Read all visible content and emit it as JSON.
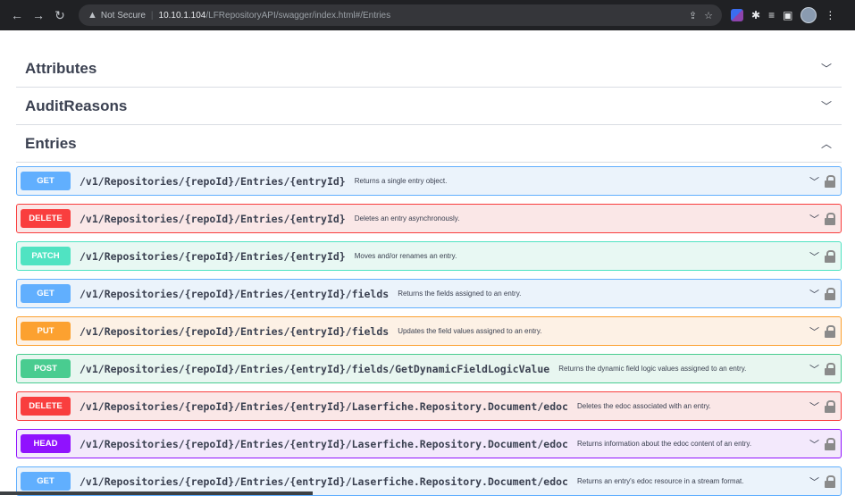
{
  "browser": {
    "security_label": "Not Secure",
    "url_host": "10.10.1.104",
    "url_path": "/LFRepositoryAPI/swagger/index.html#/Entries"
  },
  "tags": [
    {
      "name": "Attributes",
      "expanded": false
    },
    {
      "name": "AuditReasons",
      "expanded": false
    },
    {
      "name": "Entries",
      "expanded": true
    }
  ],
  "operations": [
    {
      "method": "GET",
      "path": "/v1/Repositories/{repoId}/Entries/{entryId}",
      "summary": "Returns a single entry object."
    },
    {
      "method": "DELETE",
      "path": "/v1/Repositories/{repoId}/Entries/{entryId}",
      "summary": "Deletes an entry asynchronously."
    },
    {
      "method": "PATCH",
      "path": "/v1/Repositories/{repoId}/Entries/{entryId}",
      "summary": "Moves and/or renames an entry."
    },
    {
      "method": "GET",
      "path": "/v1/Repositories/{repoId}/Entries/{entryId}/fields",
      "summary": "Returns the fields assigned to an entry."
    },
    {
      "method": "PUT",
      "path": "/v1/Repositories/{repoId}/Entries/{entryId}/fields",
      "summary": "Updates the field values assigned to an entry."
    },
    {
      "method": "POST",
      "path": "/v1/Repositories/{repoId}/Entries/{entryId}/fields/GetDynamicFieldLogicValue",
      "summary": "Returns the dynamic field logic values assigned to an entry."
    },
    {
      "method": "DELETE",
      "path": "/v1/Repositories/{repoId}/Entries/{entryId}/Laserfiche.Repository.Document/edoc",
      "summary": "Deletes the edoc associated with an entry."
    },
    {
      "method": "HEAD",
      "path": "/v1/Repositories/{repoId}/Entries/{entryId}/Laserfiche.Repository.Document/edoc",
      "summary": "Returns information about the edoc content of an entry."
    },
    {
      "method": "GET",
      "path": "/v1/Repositories/{repoId}/Entries/{entryId}/Laserfiche.Repository.Document/edoc",
      "summary": "Returns an entry's edoc resource in a stream format."
    }
  ],
  "colors": {
    "get": "#61affe",
    "delete": "#f93e3e",
    "patch": "#50e3c2",
    "put": "#fca130",
    "post": "#49cc90",
    "head": "#9012fe"
  }
}
